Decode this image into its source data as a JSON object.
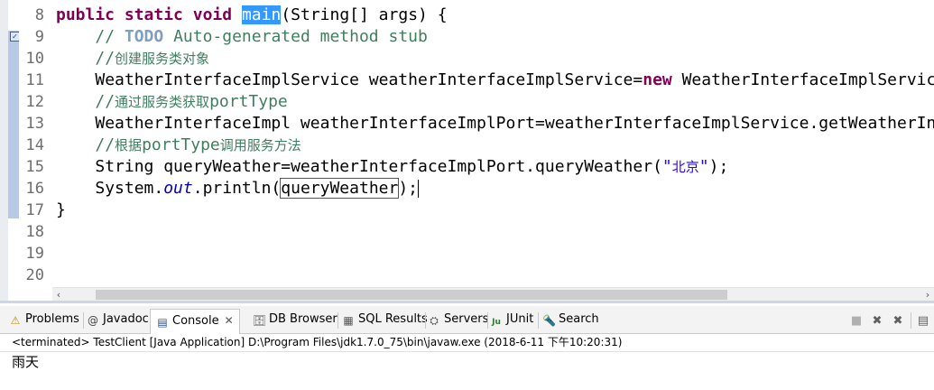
{
  "editor": {
    "line_numbers": [
      "8",
      "9",
      "10",
      "11",
      "12",
      "13",
      "14",
      "15",
      "16",
      "17",
      "18",
      "19",
      "20"
    ],
    "lines": {
      "l8": {
        "kw1": "public",
        "kw2": "static",
        "kw3": "void",
        "method": "main",
        "rest": "(String[] args) {"
      },
      "l9": {
        "pre": "// ",
        "todo": "TODO",
        "post": " Auto-generated method stub"
      },
      "l10": {
        "slashes": "//",
        "text": "创建服务类对象"
      },
      "l11": {
        "a": "WeatherInterfaceImplService weatherInterfaceImplService=",
        "kw": "new",
        "b": " WeatherInterfaceImplService();"
      },
      "l12": {
        "slashes": "//",
        "text1": "通过服务类获取",
        "text2": "portType"
      },
      "l13": {
        "a": "WeatherInterfaceImpl weatherInterfaceImplPort=weatherInterfaceImplService.getWeatherInterfaceImplPort();"
      },
      "l14": {
        "slashes": "//",
        "text1": "根据",
        "text2": "portType",
        "text3": "调用服务方法"
      },
      "l15": {
        "a": "String queryWeather=weatherInterfaceImplPort.queryWeather(",
        "str_q1": "\"",
        "str_text": "北京",
        "str_q2": "\"",
        "b": ");"
      },
      "l16": {
        "a": "System.",
        "field": "out",
        "b": ".println(",
        "var": "queryWeather",
        "c": ");"
      },
      "l17": {
        "a": "}"
      }
    }
  },
  "scrollbar": {
    "left_arrow": "‹",
    "right_arrow": "›"
  },
  "panel": {
    "tabs": {
      "problems": {
        "label": "Problems",
        "icon": "⚠"
      },
      "javadoc": {
        "label": "Javadoc",
        "icon": "@"
      },
      "console": {
        "label": "Console",
        "icon": "▤",
        "close": "✕"
      },
      "db_browser": {
        "label": "DB Browser",
        "icon": "🗄"
      },
      "sql_results": {
        "label": "SQL Results",
        "icon": "▦"
      },
      "servers": {
        "label": "Servers",
        "icon": "⛭"
      },
      "junit": {
        "label": "JUnit",
        "icon": "Ju"
      },
      "search": {
        "label": "Search",
        "icon": "🔦"
      }
    },
    "toolbar": {
      "terminate": "■",
      "remove_launch": "✖",
      "remove_all": "✖",
      "scroll_lock": "▤"
    },
    "status_text": "<terminated> TestClient [Java Application] D:\\Program Files\\jdk1.7.0_75\\bin\\javaw.exe (2018-6-11 下午10:20:31)",
    "output": "雨天"
  },
  "colors": {
    "keyword": "#7f0055",
    "comment": "#3f7f5f",
    "string": "#2a00ff",
    "field": "#0000c0",
    "selection": "#3399ff"
  }
}
